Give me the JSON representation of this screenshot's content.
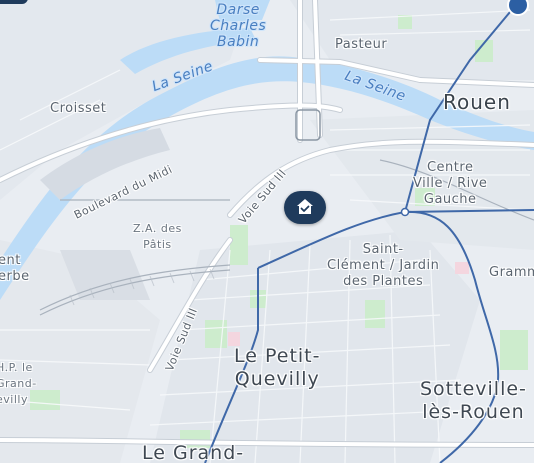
{
  "map": {
    "labels": {
      "darse": "Darse\nCharles\nBabin",
      "pasteur": "Pasteur",
      "croisset": "Croisset",
      "seine_west": "La Seine",
      "seine_east": "La Seine",
      "rouen": "Rouen",
      "boulevard_midi": "Boulevard du Midi",
      "voie_sud_upper": "Voie Sud III",
      "centre_ville": "Centre\nVille / Rive\nGauche",
      "za_patis": "Z.A. des\nPâtis",
      "saint_clement": "Saint-\nClément / Jardin\ndes Plantes",
      "gramm": "Gramm",
      "ent_erbe": "ent\nerbe",
      "voie_sud_lower": "Voie Sud III",
      "hp_grand": "H.P. le\nGrand-\nevilly",
      "petit_quevilly": "Le Petit-\nQuevilly",
      "sotteville": "Sotteville-\nlès-Rouen",
      "le_grand": "Le Grand-"
    },
    "colors": {
      "land": "#e9edf2",
      "urban": "#dfe4ea",
      "river": "#bcdcf7",
      "park": "#cdeccd",
      "road": "#ffffff",
      "road_edge": "#c7ced6",
      "transit_line": "#3f68a8",
      "marker": "#1f3b5c"
    },
    "icons": {
      "home_marker": "home-check-icon",
      "top_right_pin": "location-pin-icon"
    }
  }
}
